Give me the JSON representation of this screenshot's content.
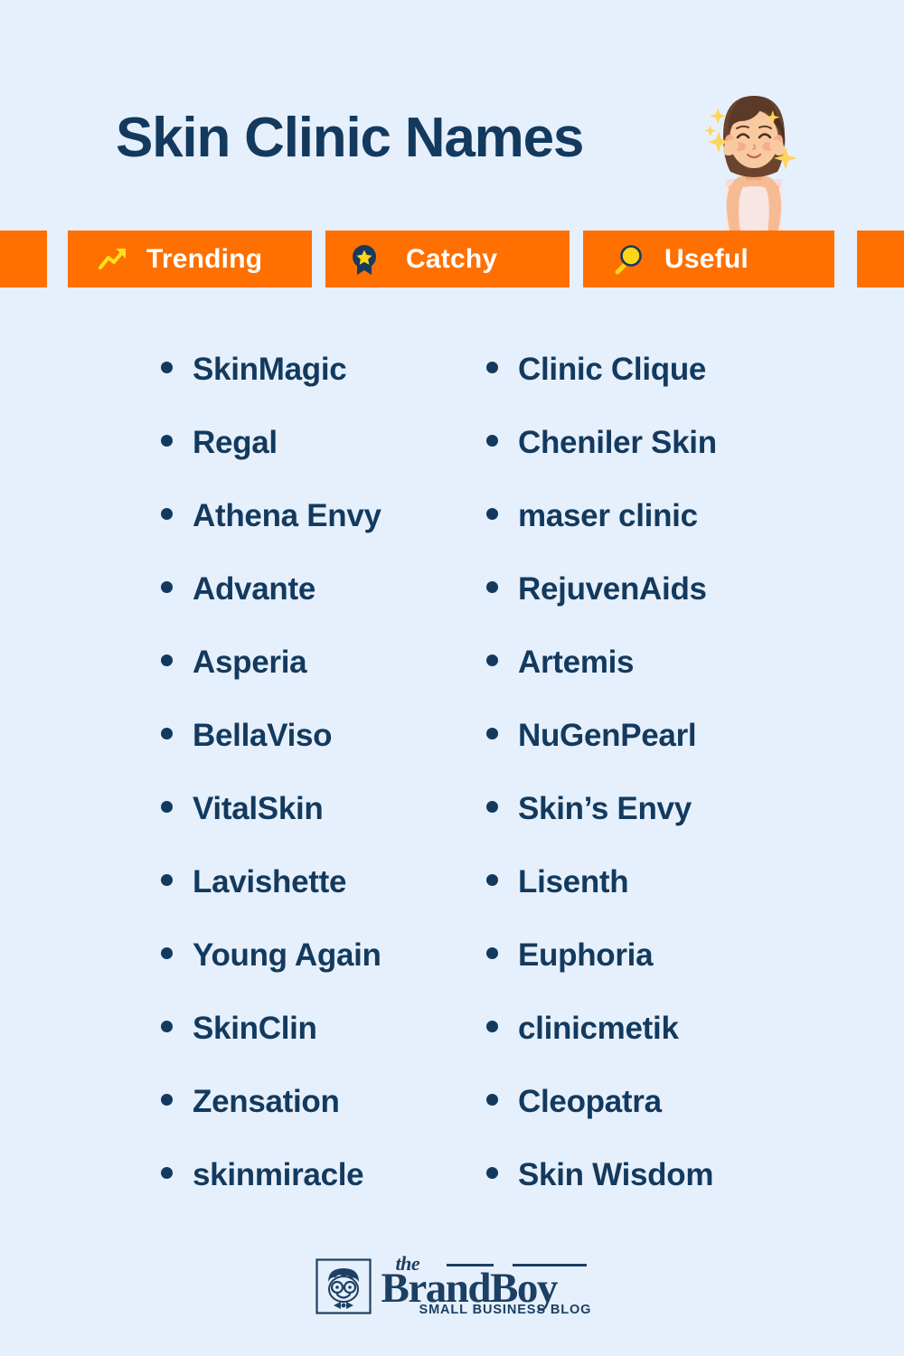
{
  "theme": {
    "background": "#e6f0fc",
    "accent_orange": "#ff7000",
    "navy": "#133a5e",
    "yellow": "#ffd816",
    "white": "#ffffff"
  },
  "header": {
    "title": "Skin Clinic Names",
    "illustration": "woman-skincare-face-illustration"
  },
  "tags": [
    {
      "label": "Trending",
      "icon": "trending-up-icon"
    },
    {
      "label": "Catchy",
      "icon": "award-badge-star-icon"
    },
    {
      "label": "Useful",
      "icon": "magnifying-glass-icon"
    }
  ],
  "lists": {
    "left_column": [
      "SkinMagic",
      "Regal",
      "Athena Envy",
      "Advante",
      "Asperia",
      "BellaViso",
      "VitalSkin",
      "Lavishette",
      "Young Again",
      "SkinClin",
      "Zensation",
      "skinmiracle"
    ],
    "right_column": [
      "Clinic Clique",
      "Cheniler Skin",
      "maser clinic",
      "RejuvenAids",
      "Artemis",
      "NuGenPearl",
      "Skin’s Envy",
      "Lisenth",
      "Euphoria",
      "clinicmetik",
      "Cleopatra",
      "Skin Wisdom"
    ]
  },
  "footer": {
    "logo_mark": "brandboy-boy-face-logo-icon",
    "the": "the",
    "brand": "BrandBoy",
    "tagline": "SMALL BUSINESS BLOG"
  }
}
